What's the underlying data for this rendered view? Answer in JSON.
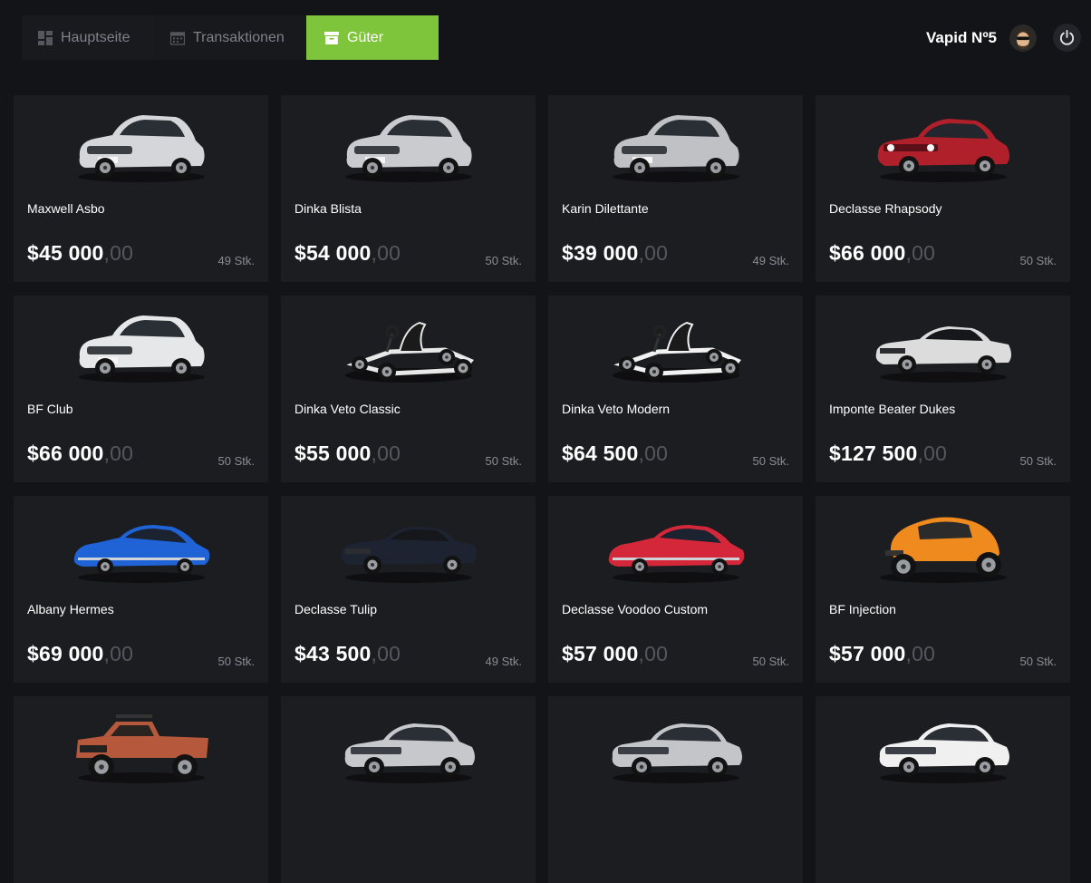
{
  "nav": {
    "tabs": [
      {
        "label": "Hauptseite",
        "icon": "dashboard-icon"
      },
      {
        "label": "Transaktionen",
        "icon": "calendar-icon"
      },
      {
        "label": "Güter",
        "icon": "archive-box-icon"
      }
    ],
    "active_index": 2
  },
  "user": {
    "name": "Vapid Nº5",
    "avatar": "avatar-image",
    "power_icon": "power-icon"
  },
  "colors": {
    "accent": "#7ec53c",
    "background": "#131417",
    "card": "#1c1d21"
  },
  "products": [
    {
      "name": "Maxwell Asbo",
      "price": "$45 000",
      "cents": ",00",
      "stock": "49 Stk.",
      "color": "#d4d6d9",
      "icon": "hatchback-car-image"
    },
    {
      "name": "Dinka Blista",
      "price": "$54 000",
      "cents": ",00",
      "stock": "50 Stk.",
      "color": "#c9cbce",
      "icon": "hatchback-car-image"
    },
    {
      "name": "Karin Dilettante",
      "price": "$39 000",
      "cents": ",00",
      "stock": "49 Stk.",
      "color": "#bfc1c4",
      "icon": "hatchback-car-image"
    },
    {
      "name": "Declasse Rhapsody",
      "price": "$66 000",
      "cents": ",00",
      "stock": "50 Stk.",
      "color": "#b0202a",
      "icon": "coupe-car-image"
    },
    {
      "name": "BF Club",
      "price": "$66 000",
      "cents": ",00",
      "stock": "50 Stk.",
      "color": "#e6e7e8",
      "icon": "hatchback-car-image"
    },
    {
      "name": "Dinka Veto Classic",
      "price": "$55 000",
      "cents": ",00",
      "stock": "50 Stk.",
      "color": "#e8e8e8",
      "icon": "go-kart-image"
    },
    {
      "name": "Dinka Veto Modern",
      "price": "$64 500",
      "cents": ",00",
      "stock": "50 Stk.",
      "color": "#f2f2f2",
      "icon": "go-kart-image"
    },
    {
      "name": "Imponte Beater Dukes",
      "price": "$127 500",
      "cents": ",00",
      "stock": "50 Stk.",
      "color": "#dcdcdc",
      "icon": "muscle-car-image"
    },
    {
      "name": "Albany Hermes",
      "price": "$69 000",
      "cents": ",00",
      "stock": "50 Stk.",
      "color": "#1f63d6",
      "icon": "classic-car-image"
    },
    {
      "name": "Declasse Tulip",
      "price": "$43 500",
      "cents": ",00",
      "stock": "49 Stk.",
      "color": "#1d2330",
      "icon": "muscle-car-image"
    },
    {
      "name": "Declasse Voodoo Custom",
      "price": "$57 000",
      "cents": ",00",
      "stock": "50 Stk.",
      "color": "#d4283a",
      "icon": "classic-car-image"
    },
    {
      "name": "BF Injection",
      "price": "$57 000",
      "cents": ",00",
      "stock": "50 Stk.",
      "color": "#ef8a1e",
      "icon": "buggy-image"
    },
    {
      "name": "",
      "price": "",
      "cents": "",
      "stock": "",
      "color": "#b5583c",
      "icon": "pickup-truck-image"
    },
    {
      "name": "",
      "price": "",
      "cents": "",
      "stock": "",
      "color": "#c6c8cb",
      "icon": "sedan-car-image"
    },
    {
      "name": "",
      "price": "",
      "cents": "",
      "stock": "",
      "color": "#c3c5c8",
      "icon": "sedan-car-image"
    },
    {
      "name": "",
      "price": "",
      "cents": "",
      "stock": "",
      "color": "#f0f0f0",
      "icon": "sedan-car-image"
    }
  ]
}
